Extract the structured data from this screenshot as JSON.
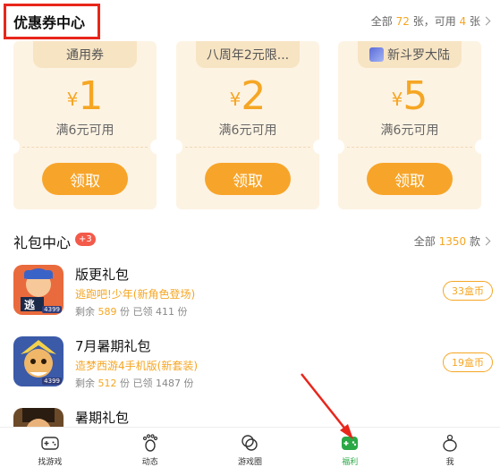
{
  "coupon_section": {
    "title": "优惠券中心",
    "summary_prefix": "全部 ",
    "total": "72",
    "summary_mid": " 张，可用 ",
    "available": "4",
    "summary_suffix": " 张"
  },
  "coupons": [
    {
      "tag": "通用券",
      "symbol": "¥",
      "amount": "1",
      "condition": "满6元可用",
      "button": "领取",
      "has_game_icon": false
    },
    {
      "tag": "八周年2元限...",
      "symbol": "¥",
      "amount": "2",
      "condition": "满6元可用",
      "button": "领取",
      "has_game_icon": false
    },
    {
      "tag": "新斗罗大陆",
      "symbol": "¥",
      "amount": "5",
      "condition": "满6元可用",
      "button": "领取",
      "has_game_icon": true
    }
  ],
  "gift_section": {
    "title": "礼包中心",
    "badge": "+3",
    "summary_prefix": "全部 ",
    "total": "1350",
    "summary_suffix": " 款"
  },
  "gifts": [
    {
      "name": "版更礼包",
      "game": "逃跑吧!少年(新角色登场)",
      "stock_label": "剩余",
      "stock": "589",
      "unit1": "份",
      "claimed": "已领 411 份",
      "price": "33盒币",
      "icon_text": "逃",
      "icon_stamp": "4399"
    },
    {
      "name": "7月暑期礼包",
      "game": "造梦西游4手机版(新套装)",
      "stock_label": "剩余",
      "stock": "512",
      "unit1": "份",
      "claimed": "已领 1487 份",
      "price": "19盒币",
      "icon_text": "",
      "icon_stamp": "4399"
    },
    {
      "name": "暑期礼包",
      "game": "",
      "stock_label": "",
      "stock": "",
      "unit1": "",
      "claimed": "",
      "price": "",
      "icon_text": "",
      "icon_stamp": ""
    }
  ],
  "bottom_nav": [
    {
      "label": "找游戏",
      "icon": "gamepad-icon",
      "active": false
    },
    {
      "label": "动态",
      "icon": "footprint-icon",
      "active": false
    },
    {
      "label": "游戏圈",
      "icon": "circles-icon",
      "active": false
    },
    {
      "label": "福利",
      "icon": "gift-box-icon",
      "active": true
    },
    {
      "label": "我",
      "icon": "person-icon",
      "active": false
    }
  ],
  "colors": {
    "accent": "#f5a623",
    "button": "#f7a52a",
    "coupon_bg": "#fdf3e3",
    "active_nav": "#2aa845",
    "annotation": "#e8261b"
  }
}
